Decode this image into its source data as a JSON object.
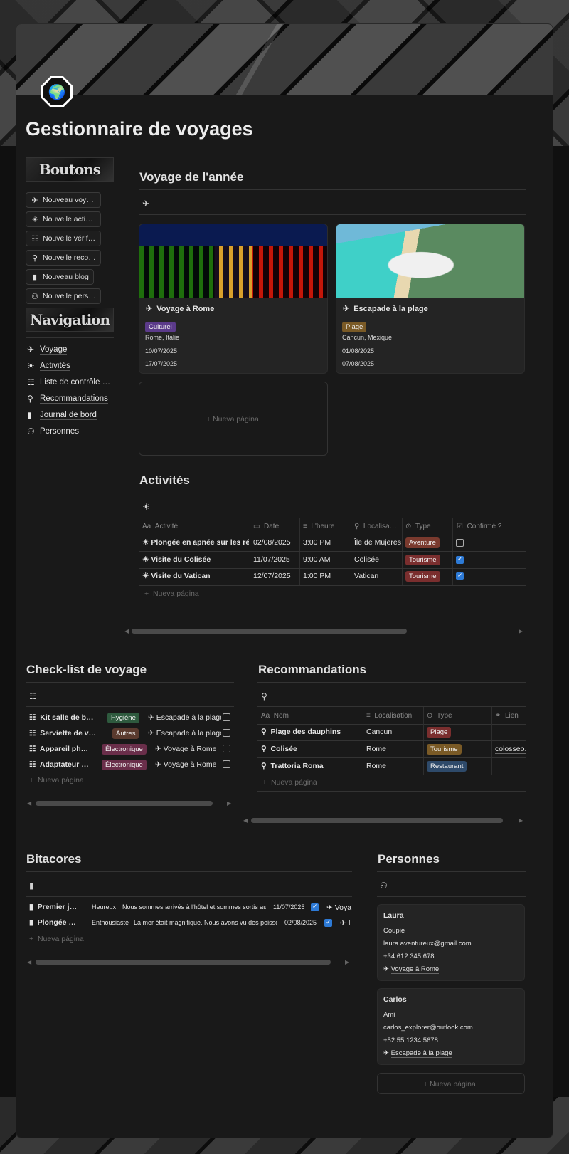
{
  "title": "Gestionnaire de voyages",
  "sidebar": {
    "banner_buttons": "Boutons",
    "banner_nav": "Navigation",
    "buttons": [
      {
        "label": "Nouveau voy…",
        "icon": "plane-icon"
      },
      {
        "label": "Nouvelle acti…",
        "icon": "sun-icon"
      },
      {
        "label": "Nouvelle vérif…",
        "icon": "checklist-icon"
      },
      {
        "label": "Nouvelle reco…",
        "icon": "bulb-icon"
      },
      {
        "label": "Nouveau blog",
        "icon": "book-icon"
      },
      {
        "label": "Nouvelle pers…",
        "icon": "people-icon"
      }
    ],
    "nav": [
      {
        "label": "Voyage",
        "icon": "plane-icon"
      },
      {
        "label": "Activités",
        "icon": "sun-icon"
      },
      {
        "label": "Liste de contrôle …",
        "icon": "checklist-icon"
      },
      {
        "label": "Recommandations",
        "icon": "bulb-icon"
      },
      {
        "label": "Journal de bord",
        "icon": "book-icon"
      },
      {
        "label": "Personnes",
        "icon": "people-icon"
      }
    ]
  },
  "voyage": {
    "heading": "Voyage de l'année",
    "cards": [
      {
        "name": "Voyage à Rome",
        "tag": "Culturel",
        "tag_color": "#5b3a8a",
        "place": "Rome, Italie",
        "start": "10/07/2025",
        "end": "17/07/2025"
      },
      {
        "name": "Escapade à la plage",
        "tag": "Plage",
        "tag_color": "#7a5a26",
        "place": "Cancun, Mexique",
        "start": "01/08/2025",
        "end": "07/08/2025"
      }
    ],
    "new_page": "Nueva página"
  },
  "activites": {
    "heading": "Activités",
    "columns": [
      "Activité",
      "Date",
      "L'heure",
      "Localisa…",
      "Type",
      "Confirmé ?"
    ],
    "rows": [
      {
        "name": "Plongée en apnée sur les récifs",
        "date": "02/08/2025",
        "time": "3:00 PM",
        "loc": "Île de Mujeres",
        "type": "Aventure",
        "type_color": "#7a3a2e",
        "confirmed": false
      },
      {
        "name": "Visite du Colisée",
        "date": "11/07/2025",
        "time": "9:00 AM",
        "loc": "Colisée",
        "type": "Tourisme",
        "type_color": "#7a2e2e",
        "confirmed": true
      },
      {
        "name": "Visite du Vatican",
        "date": "12/07/2025",
        "time": "1:00 PM",
        "loc": "Vatican",
        "type": "Tourisme",
        "type_color": "#7a2e2e",
        "confirmed": true
      }
    ],
    "new_page": "Nueva página"
  },
  "checklist": {
    "heading": "Check-list de voyage",
    "rows": [
      {
        "name": "Kit salle de b…",
        "tag": "Hygiène",
        "tag_color": "#2e5a3e",
        "trip": "Escapade à la plage"
      },
      {
        "name": "Serviette de v…",
        "tag": "Autres",
        "tag_color": "#5a3a2e",
        "trip": "Escapade à la plage"
      },
      {
        "name": "Appareil ph…",
        "tag": "Électronique",
        "tag_color": "#6a2e4a",
        "trip": "Voyage à Rome"
      },
      {
        "name": "Adaptateur …",
        "tag": "Électronique",
        "tag_color": "#6a2e4a",
        "trip": "Voyage à Rome"
      }
    ],
    "new_page": "Nueva página"
  },
  "reco": {
    "heading": "Recommandations",
    "columns": [
      "Nom",
      "Localisation",
      "Type",
      "Lien"
    ],
    "rows": [
      {
        "name": "Plage des dauphins",
        "loc": "Cancun",
        "type": "Plage",
        "type_color": "#7a2e2e",
        "link": ""
      },
      {
        "name": "Colisée",
        "loc": "Rome",
        "type": "Tourisme",
        "type_color": "#7a5a26",
        "link": "colosseo.i"
      },
      {
        "name": "Trattoria Roma",
        "loc": "Rome",
        "type": "Restaurant",
        "type_color": "#2e4a6a",
        "link": ""
      }
    ],
    "new_page": "Nueva página"
  },
  "bitacores": {
    "heading": "Bitacores",
    "rows": [
      {
        "name": "Premier j…",
        "mood": "Heureux",
        "text": "Nous sommes arrivés à l'hôtel et sommes sortis au …",
        "date": "11/07/2025",
        "trip": "Voya"
      },
      {
        "name": "Plongée …",
        "mood": "Enthousiaste",
        "text": "La mer était magnifique. Nous avons vu des poisson…",
        "date": "02/08/2025",
        "trip": "I"
      }
    ],
    "new_page": "Nueva página"
  },
  "personnes": {
    "heading": "Personnes",
    "people": [
      {
        "name": "Laura",
        "relation": "Coupie",
        "email": "laura.aventureux@gmail.com",
        "phone": "+34 612 345 678",
        "trip": "Voyage à Rome"
      },
      {
        "name": "Carlos",
        "relation": "Ami",
        "email": "carlos_explorer@outlook.com",
        "phone": "+52 55 1234 5678",
        "trip": "Escapade à la plage"
      }
    ],
    "new_page": "Nueva página"
  },
  "icons": {
    "plane": "✈",
    "sun": "☀",
    "checklist": "☷",
    "bulb": "💡",
    "book": "▮",
    "people": "👥"
  }
}
